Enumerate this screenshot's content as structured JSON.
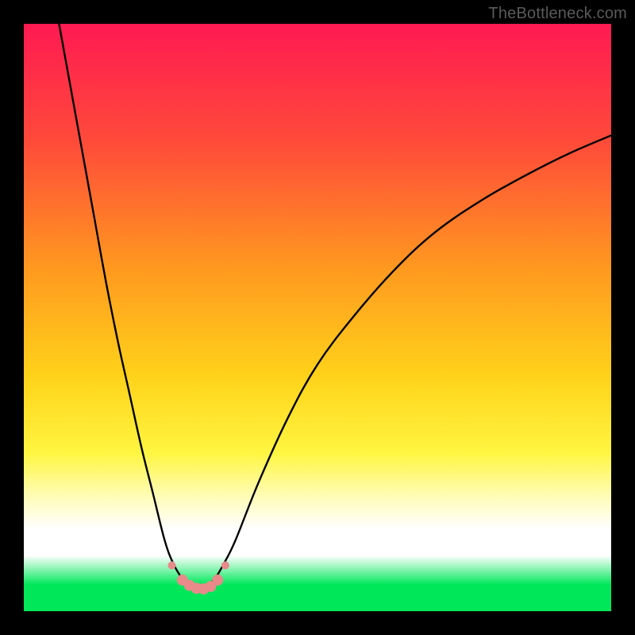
{
  "watermark": "TheBottleneck.com",
  "chart_data": {
    "type": "line",
    "title": "",
    "xlabel": "",
    "ylabel": "",
    "xlim": [
      0,
      100
    ],
    "ylim": [
      0,
      100
    ],
    "gradient_stops": [
      {
        "offset": 0.0,
        "color": "#ff1a52"
      },
      {
        "offset": 0.2,
        "color": "#ff4a3a"
      },
      {
        "offset": 0.42,
        "color": "#ff9a1f"
      },
      {
        "offset": 0.6,
        "color": "#ffd21a"
      },
      {
        "offset": 0.73,
        "color": "#fff540"
      },
      {
        "offset": 0.8,
        "color": "#fffcb0"
      },
      {
        "offset": 0.86,
        "color": "#ffffff"
      },
      {
        "offset": 0.905,
        "color": "#ffffff"
      },
      {
        "offset": 0.955,
        "color": "#00e85a"
      },
      {
        "offset": 1.0,
        "color": "#00e85a"
      }
    ],
    "series": [
      {
        "name": "left-curve",
        "x": [
          6,
          8,
          10,
          12,
          14,
          16,
          18,
          20,
          22,
          24,
          25.5,
          27,
          28,
          29,
          30
        ],
        "y": [
          100,
          89,
          78,
          67,
          56,
          46,
          37,
          28,
          20,
          12,
          8,
          5.5,
          4.5,
          4,
          3.8
        ]
      },
      {
        "name": "right-curve",
        "x": [
          30,
          31,
          32.5,
          34,
          36,
          40,
          45,
          50,
          56,
          63,
          70,
          78,
          86,
          93,
          100
        ],
        "y": [
          3.8,
          4.2,
          5.5,
          8,
          12,
          22,
          33,
          42,
          50,
          58,
          64.5,
          70,
          74.5,
          78,
          81
        ]
      }
    ],
    "markers": {
      "name": "bottom-dots",
      "color": "#e88a8a",
      "radius_small": 5,
      "radius_large": 7,
      "points": [
        {
          "x": 25.2,
          "y": 7.8,
          "r": "small"
        },
        {
          "x": 27.0,
          "y": 5.3,
          "r": "large"
        },
        {
          "x": 28.2,
          "y": 4.4,
          "r": "large"
        },
        {
          "x": 29.4,
          "y": 3.9,
          "r": "large"
        },
        {
          "x": 30.6,
          "y": 3.8,
          "r": "large"
        },
        {
          "x": 31.8,
          "y": 4.2,
          "r": "large"
        },
        {
          "x": 33.0,
          "y": 5.3,
          "r": "large"
        },
        {
          "x": 34.3,
          "y": 7.8,
          "r": "small"
        }
      ]
    }
  }
}
